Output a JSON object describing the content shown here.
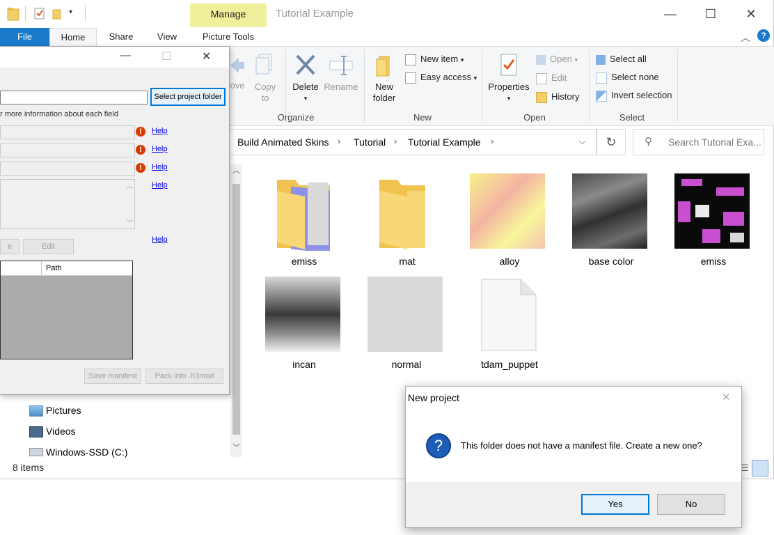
{
  "window": {
    "title": "Tutorial Example",
    "manage_tab": "Manage",
    "controls": {
      "minimize": "—",
      "maximize": "☐",
      "close": "✕"
    }
  },
  "ribbon_tabs": {
    "file": "File",
    "home": "Home",
    "share": "Share",
    "view": "View",
    "picture_tools": "Picture Tools"
  },
  "ribbon": {
    "move_to": "ove",
    "copy_to": [
      "Copy",
      "to"
    ],
    "delete": "Delete",
    "rename": "Rename",
    "new_folder": [
      "New",
      "folder"
    ],
    "new_item": "New item",
    "easy_access": "Easy access",
    "properties": "Properties",
    "open": "Open",
    "edit": "Edit",
    "history": "History",
    "select_all": "Select all",
    "select_none": "Select none",
    "invert_selection": "Invert selection",
    "groups": {
      "organize": "Organize",
      "new": "New",
      "open": "Open",
      "select": "Select"
    }
  },
  "address": {
    "crumbs": [
      "Build Animated Skins",
      "Tutorial",
      "Tutorial Example"
    ],
    "search_placeholder": "Search Tutorial Exa..."
  },
  "files": [
    {
      "name": "emiss",
      "kind": "folder-with-image"
    },
    {
      "name": "mat",
      "kind": "folder"
    },
    {
      "name": "alloy",
      "kind": "image"
    },
    {
      "name": "base color",
      "kind": "image"
    },
    {
      "name": "emiss",
      "kind": "image"
    },
    {
      "name": "incan",
      "kind": "image"
    },
    {
      "name": "normal",
      "kind": "image"
    },
    {
      "name": "tdam_puppet",
      "kind": "file"
    }
  ],
  "nav": {
    "items": [
      "Pictures",
      "Videos",
      "Windows-SSD (C:)"
    ]
  },
  "status": {
    "item_count": "8 items"
  },
  "tool": {
    "select_project_folder": "Select project folder",
    "info_text": "r more information about each field",
    "help": "Help",
    "edit": "Edit",
    "partial_btn": "e",
    "table_header_path": "Path",
    "save_manifest": "Save manifest",
    "pack_into": "Pack into .h3mod"
  },
  "dialog": {
    "title": "New project",
    "message": "This folder does not have a manifest file. Create a new one?",
    "yes": "Yes",
    "no": "No"
  },
  "colors": {
    "accent": "#1979ca",
    "manage_tab": "#f0ef9c",
    "dialog_icon": "#1d5db6"
  }
}
